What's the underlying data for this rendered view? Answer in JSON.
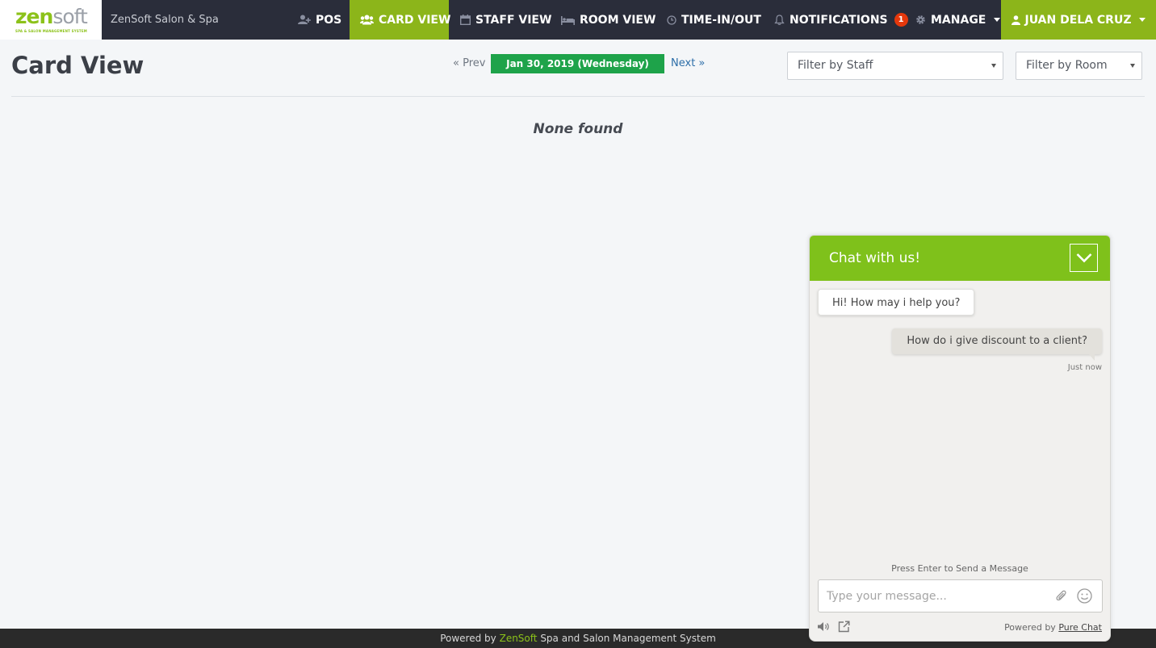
{
  "brand": {
    "logo_zen": "zen",
    "logo_soft": "soft",
    "logo_tagline": "SPA & SALON MANAGEMENT SYSTEM",
    "name": "ZenSoft Salon & Spa"
  },
  "nav": {
    "pos": "POS",
    "card_view": "CARD VIEW",
    "staff_view": "STAFF VIEW",
    "room_view": "ROOM VIEW",
    "time_in_out": "TIME-IN/OUT",
    "notifications": "NOTIFICATIONS",
    "notifications_count": "1",
    "manage": "MANAGE",
    "user": "JUAN DELA CRUZ"
  },
  "page": {
    "title": "Card View",
    "prev": "« Prev",
    "date": "Jan 30, 2019 (Wednesday)",
    "next": "Next »",
    "filter_staff": "Filter by Staff",
    "filter_room": "Filter by Room",
    "empty_message": "None found"
  },
  "footer": {
    "prefix": "Powered by",
    "brand": "ZenSoft",
    "suffix": "Spa and Salon Management System"
  },
  "chat": {
    "title": "Chat with us!",
    "messages": [
      {
        "from": "agent",
        "text": "Hi! How may i help you?"
      },
      {
        "from": "visitor",
        "text": "How do i give discount to a client?",
        "time": "Just now"
      }
    ],
    "hint": "Press Enter to Send a Message",
    "input_placeholder": "Type your message...",
    "powered_prefix": "Powered by",
    "powered_link": "Pure Chat"
  },
  "colors": {
    "nav_bg": "#2a2d3a",
    "accent_green": "#8cb51a",
    "chat_green": "#7fc11b",
    "date_green": "#1ea34a",
    "badge_red": "#e5380c",
    "footer_bg": "#2a2a2a"
  },
  "icons": {
    "pos": "user-plus-icon",
    "card_view": "users-icon",
    "staff_view": "calendar-icon",
    "room_view": "bed-icon",
    "time_in_out": "clock-icon",
    "notifications": "bell-icon",
    "manage": "gear-icon",
    "user": "user-icon"
  }
}
